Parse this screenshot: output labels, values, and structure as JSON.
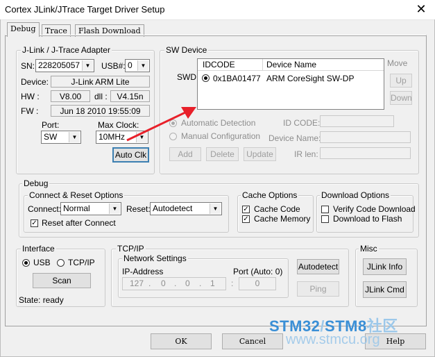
{
  "window": {
    "title": "Cortex JLink/JTrace Target Driver Setup",
    "close": "✕"
  },
  "tabs": [
    {
      "label": "Debug"
    },
    {
      "label": "Trace"
    },
    {
      "label": "Flash Download"
    }
  ],
  "adapter": {
    "title": "J-Link / J-Trace Adapter",
    "sn_label": "SN:",
    "sn_value": "228205057",
    "usb_label": "USB#:",
    "usb_value": "0",
    "device_label": "Device:",
    "device_value": "J-Link ARM Lite",
    "hw_label": "HW :",
    "hw_value": "V8.00",
    "dll_label": "dll :",
    "dll_value": "V4.15n",
    "fw_label": "FW :",
    "fw_value": "Jun 18 2010 19:55:09",
    "port_label": "Port:",
    "port_value": "SW",
    "maxclock_label": "Max Clock:",
    "maxclock_value": "10MHz",
    "autoclk_label": "Auto Clk"
  },
  "sw_device": {
    "title": "SW Device",
    "swd_label": "SWD",
    "columns": [
      "IDCODE",
      "Device Name"
    ],
    "rows": [
      {
        "idcode": "0x1BA01477",
        "name": "ARM CoreSight SW-DP"
      }
    ],
    "move_label": "Move",
    "up_label": "Up",
    "down_label": "Down",
    "auto_detect_label": "Automatic Detection",
    "manual_config_label": "Manual Configuration",
    "idcode_label": "ID CODE:",
    "device_name_label": "Device Name:",
    "irlen_label": "IR len:",
    "add_label": "Add",
    "delete_label": "Delete",
    "update_label": "Update"
  },
  "debug": {
    "title": "Debug",
    "connect_reset_title": "Connect & Reset Options",
    "connect_label": "Connect:",
    "connect_value": "Normal",
    "reset_label": "Reset:",
    "reset_value": "Autodetect",
    "reset_after_connect_label": "Reset after Connect",
    "cache_title": "Cache Options",
    "cache_code_label": "Cache Code",
    "cache_memory_label": "Cache Memory",
    "download_title": "Download Options",
    "verify_label": "Verify Code Download",
    "download_flash_label": "Download to Flash"
  },
  "interface": {
    "title": "Interface",
    "usb_label": "USB",
    "tcpip_label": "TCP/IP",
    "scan_label": "Scan",
    "state_label": "State: ready"
  },
  "tcpip": {
    "title": "TCP/IP",
    "network_title": "Network Settings",
    "ip_label": "IP-Address",
    "port_label": "Port (Auto: 0)",
    "ip_octets": [
      "127",
      "0",
      "0",
      "1"
    ],
    "ip_dot": ".",
    "colon": ":",
    "port_value": "0",
    "autodetect_label": "Autodetect",
    "ping_label": "Ping"
  },
  "misc": {
    "title": "Misc",
    "jlink_info_label": "JLink Info",
    "jlink_cmd_label": "JLink Cmd"
  },
  "footer": {
    "ok_label": "OK",
    "cancel_label": "Cancel",
    "help_label": "Help"
  },
  "watermark": {
    "part1": "STM32",
    "slash": "/",
    "part2": "STM8",
    "part3": "社区",
    "url": "www.stmcu.org"
  },
  "colors": {
    "accent": "#3c7fb1",
    "arrow": "#e8202a",
    "watermark_blue": "#3a8fd6",
    "watermark_light": "#9cc8ea"
  }
}
